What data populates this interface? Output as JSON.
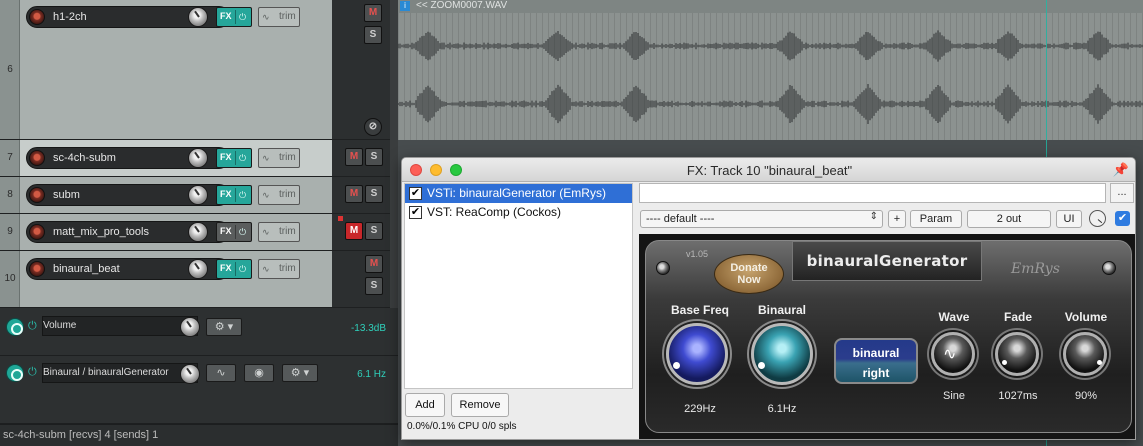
{
  "tracks": [
    {
      "number": "",
      "name": "h1-2ch"
    },
    {
      "number": "6",
      "name": ""
    },
    {
      "number": "7",
      "name": "sc-4ch-subm"
    },
    {
      "number": "8",
      "name": "subm"
    },
    {
      "number": "9",
      "name": "matt_mix_pro_tools"
    },
    {
      "number": "10",
      "name": "binaural_beat"
    }
  ],
  "buttons": {
    "fx": "FX",
    "trim": "trim",
    "mute": "M",
    "solo": "S",
    "phase": "⊘"
  },
  "lanes": {
    "volume": {
      "name": "Volume",
      "value": "-13.3dB"
    },
    "binaural": {
      "name": "Binaural / binauralGenerator",
      "value": "6.1 Hz"
    }
  },
  "status_bar": "sc-4ch-subm [recvs] 4 [sends] 1",
  "media_item": {
    "badge": "i",
    "name": "<< ZOOM0007.WAV"
  },
  "fx_window": {
    "title": "FX: Track 10 \"binaural_beat\"",
    "chain": [
      {
        "name": "VSTi: binauralGenerator (EmRys)",
        "enabled": true,
        "selected": true
      },
      {
        "name": "VST: ReaComp (Cockos)",
        "enabled": true,
        "selected": false
      }
    ],
    "add_label": "Add",
    "remove_label": "Remove",
    "cpu": "0.0%/0.1% CPU 0/0 spls",
    "preset": "---- default ----",
    "plus_label": "+",
    "param_label": "Param",
    "outputs_label": "2 out",
    "ui_label": "UI",
    "more_label": "..."
  },
  "plugin": {
    "version": "v1.05",
    "donate_line1": "Donate",
    "donate_line2": "Now",
    "brand": "binauralGenerator",
    "logo": "EmRys",
    "base_freq": {
      "label": "Base Freq",
      "value": "229Hz"
    },
    "binaural": {
      "label": "Binaural",
      "value": "6.1Hz"
    },
    "mode_line1": "binaural",
    "mode_line2": "right",
    "wave": {
      "label": "Wave",
      "value": "Sine"
    },
    "fade": {
      "label": "Fade",
      "value": "1027ms"
    },
    "volume": {
      "label": "Volume",
      "value": "90%"
    }
  },
  "colors": {
    "accent": "#26a69a",
    "selection": "#2f6fd6",
    "mute_on": "#c8272a"
  }
}
